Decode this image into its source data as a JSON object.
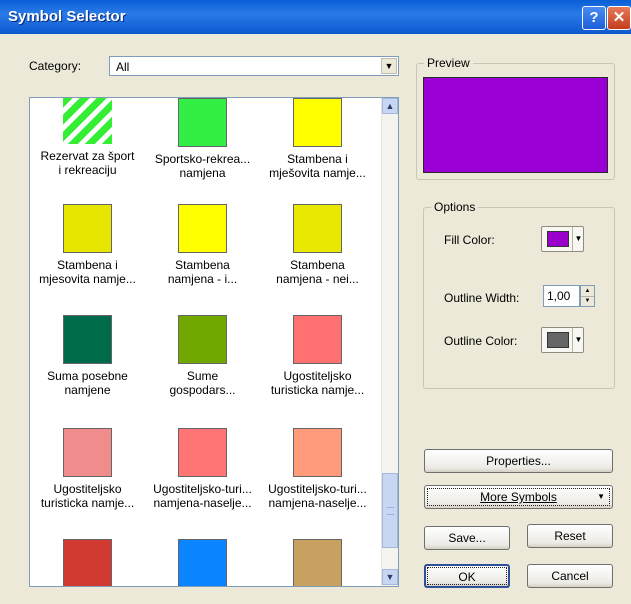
{
  "window": {
    "title": "Symbol Selector",
    "help_glyph": "?",
    "close_glyph": "✕"
  },
  "category": {
    "label": "Category:",
    "value": "All"
  },
  "scroll": {
    "up_glyph": "▲",
    "down_glyph": "▼"
  },
  "symbols": [
    {
      "label": "Rezervat za šport\ni rekreaciju",
      "color": "#33ee33",
      "pattern": "hatch"
    },
    {
      "label": "Sportsko-rekrea...\nnamjena",
      "color": "#33ee44"
    },
    {
      "label": "Stambena i\nmješovita namje...",
      "color": "#ffff00"
    },
    {
      "label": "Stambena i\nmjesovita namje...",
      "color": "#e6e600"
    },
    {
      "label": "Stambena\nnamjena - i...",
      "color": "#ffff00"
    },
    {
      "label": "Stambena\nnamjena - nei...",
      "color": "#e8e800"
    },
    {
      "label": "Suma posebne\nnamjene",
      "color": "#006b4a"
    },
    {
      "label": "Sume\ngospodars...",
      "color": "#70a800"
    },
    {
      "label": "Ugostiteljsko\nturisticka namje...",
      "color": "#ff7070"
    },
    {
      "label": "Ugostiteljsko\nturisticka namje...",
      "color": "#f08c8c"
    },
    {
      "label": "Ugostiteljsko-turi...\nnamjena-naselje...",
      "color": "#ff7575"
    },
    {
      "label": "Ugostiteljsko-turi...\nnamjena-naselje...",
      "color": "#ff9a7a"
    },
    {
      "label": "",
      "color": "#d03a30"
    },
    {
      "label": "",
      "color": "#0a84ff"
    },
    {
      "label": "",
      "color": "#c8a060"
    }
  ],
  "preview": {
    "label": "Preview",
    "color": "#9a00d6"
  },
  "options": {
    "label": "Options",
    "fill_color_label": "Fill Color:",
    "fill_color": "#9900cc",
    "outline_width_label": "Outline Width:",
    "outline_width": "1,00",
    "outline_color_label": "Outline Color:",
    "outline_color": "#666666"
  },
  "buttons": {
    "properties": "Properties...",
    "more_symbols": "More Symbols",
    "save": "Save...",
    "reset": "Reset",
    "ok": "OK",
    "cancel": "Cancel"
  }
}
